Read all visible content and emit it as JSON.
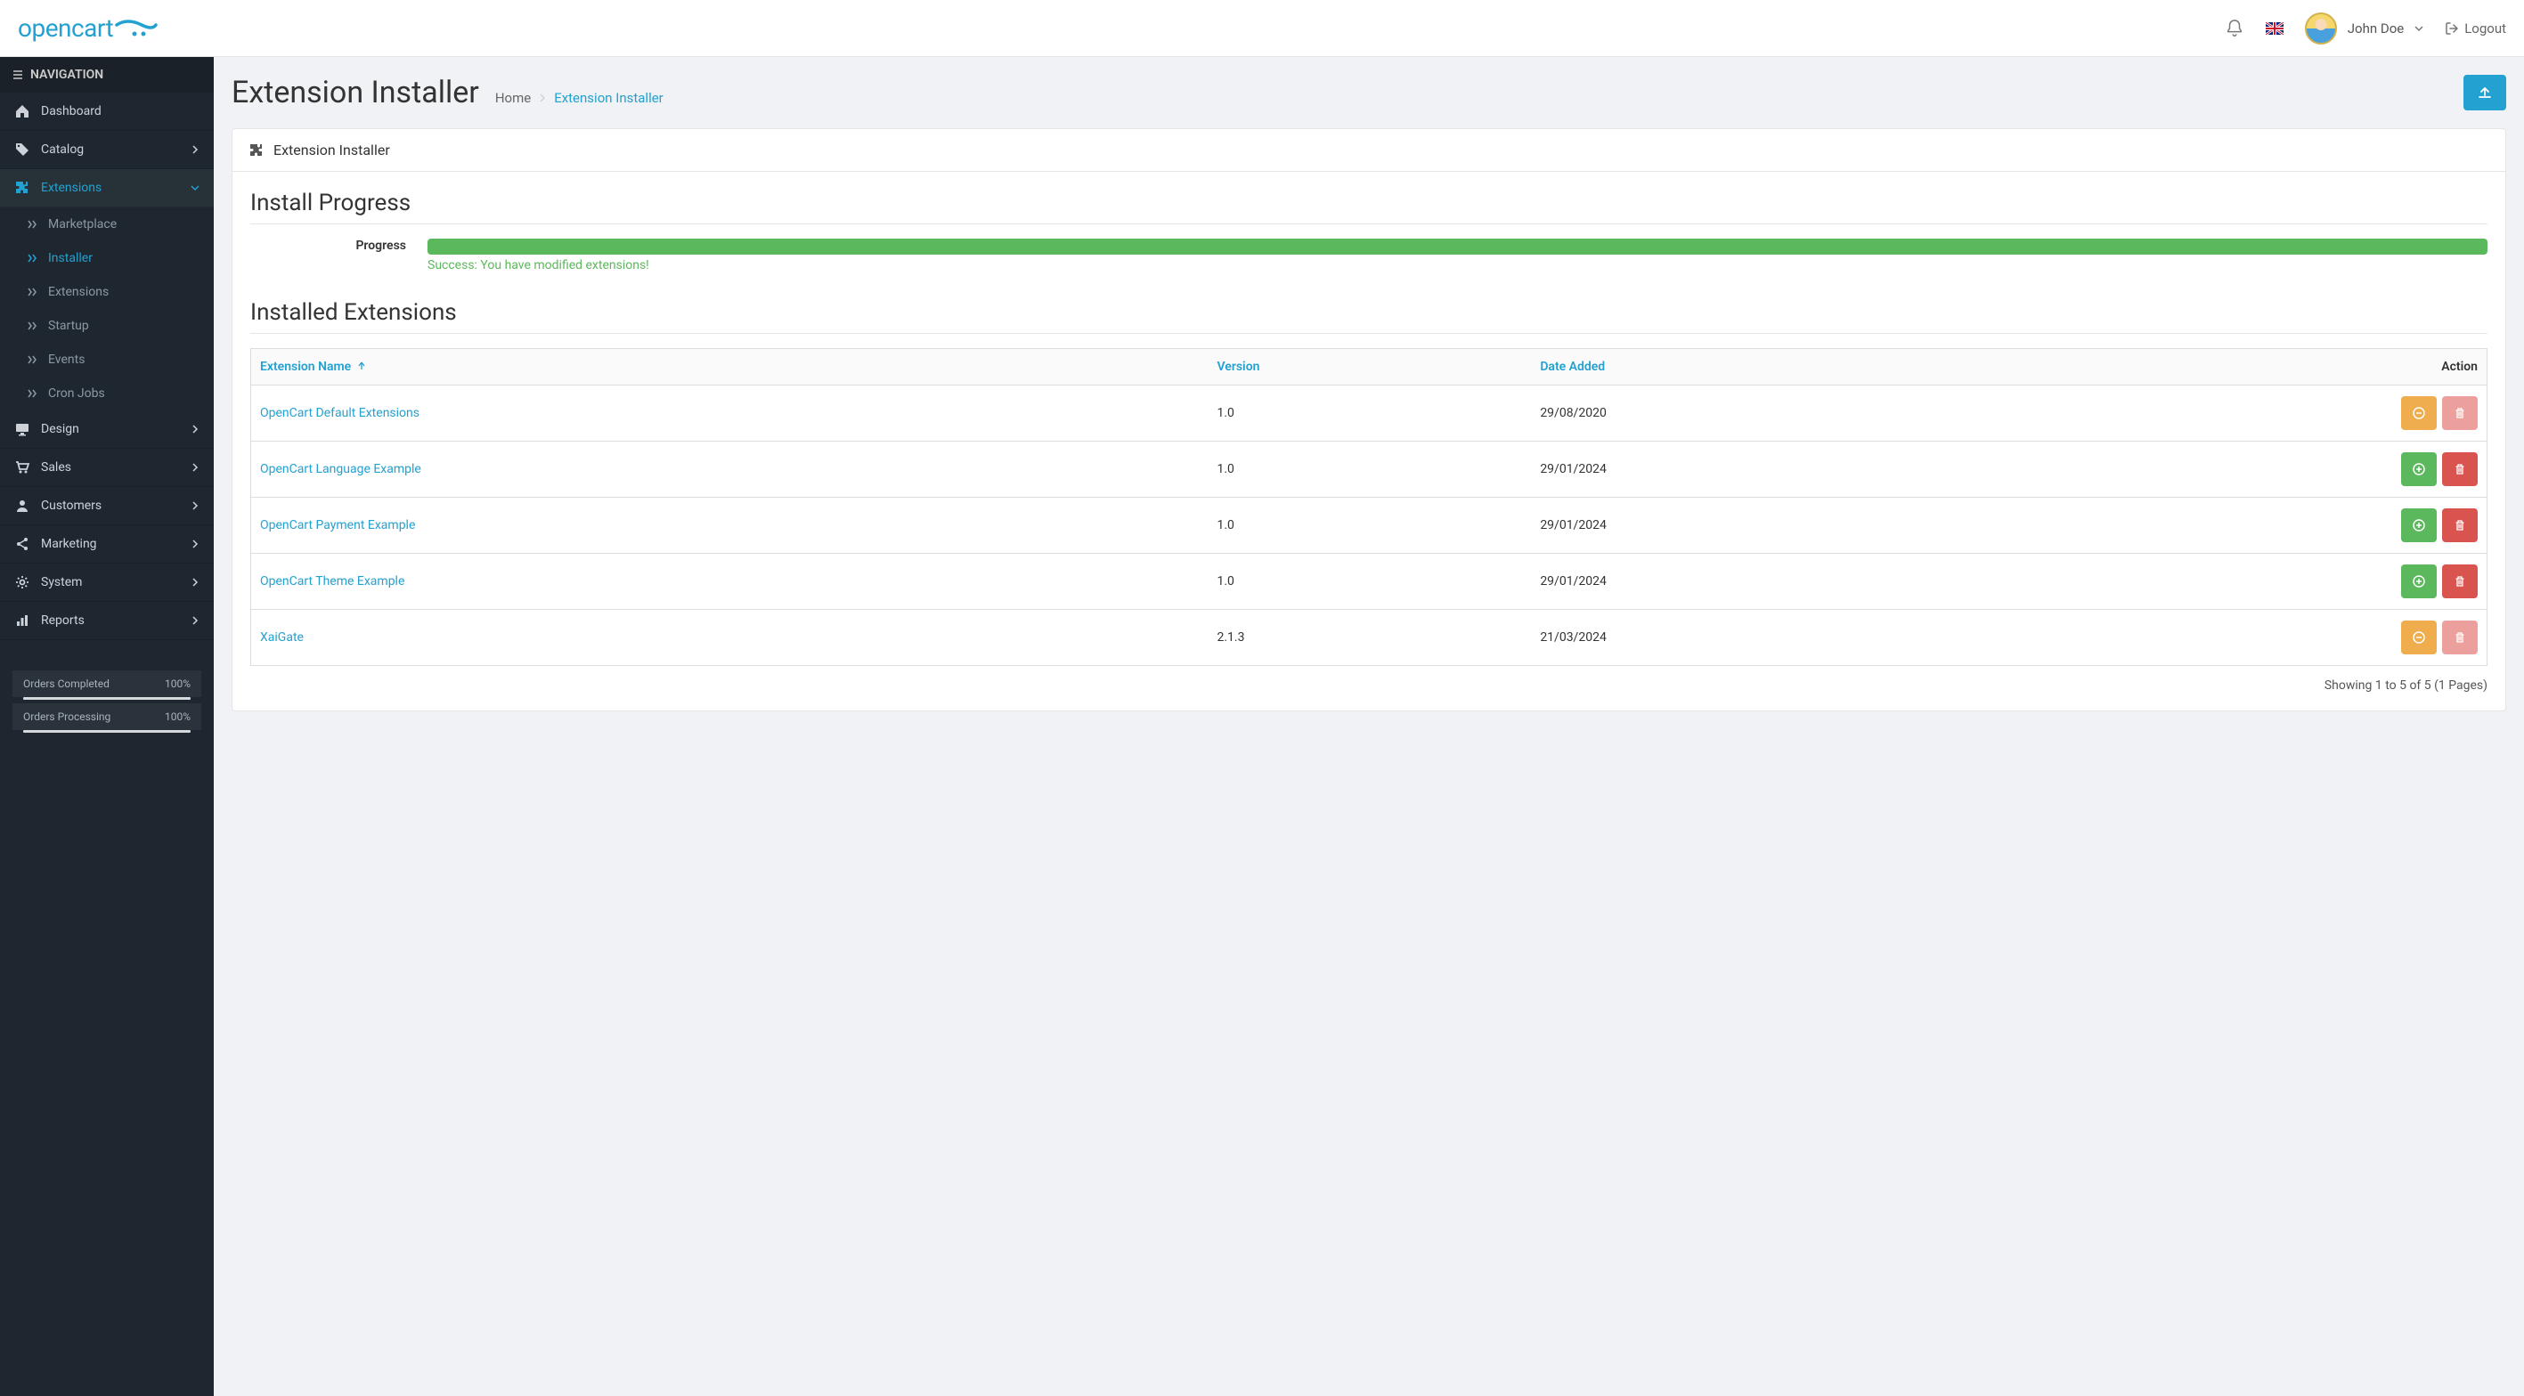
{
  "header": {
    "logo_text": "opencart",
    "user_name": "John Doe",
    "logout_label": "Logout"
  },
  "sidebar": {
    "nav_label": "NAVIGATION",
    "items": [
      {
        "icon": "home",
        "label": "Dashboard"
      },
      {
        "icon": "tag",
        "label": "Catalog",
        "expandable": true
      },
      {
        "icon": "puzzle",
        "label": "Extensions",
        "expandable": true,
        "active": true
      },
      {
        "icon": "monitor",
        "label": "Design",
        "expandable": true
      },
      {
        "icon": "cart",
        "label": "Sales",
        "expandable": true
      },
      {
        "icon": "user",
        "label": "Customers",
        "expandable": true
      },
      {
        "icon": "share",
        "label": "Marketing",
        "expandable": true
      },
      {
        "icon": "gear",
        "label": "System",
        "expandable": true
      },
      {
        "icon": "chart",
        "label": "Reports",
        "expandable": true
      }
    ],
    "sub_extensions": [
      {
        "label": "Marketplace"
      },
      {
        "label": "Installer",
        "active": true
      },
      {
        "label": "Extensions"
      },
      {
        "label": "Startup"
      },
      {
        "label": "Events"
      },
      {
        "label": "Cron Jobs"
      }
    ],
    "stats": [
      {
        "label": "Orders Completed",
        "value": "100%"
      },
      {
        "label": "Orders Processing",
        "value": "100%"
      }
    ]
  },
  "page": {
    "title": "Extension Installer",
    "breadcrumb_home": "Home",
    "breadcrumb_current": "Extension Installer",
    "panel_title": "Extension Installer",
    "progress_heading": "Install Progress",
    "progress_label": "Progress",
    "progress_message": "Success: You have modified extensions!",
    "installed_heading": "Installed Extensions",
    "columns": {
      "name": "Extension Name",
      "version": "Version",
      "date": "Date Added",
      "action": "Action"
    },
    "rows": [
      {
        "name": "OpenCart Default Extensions",
        "version": "1.0",
        "date": "29/08/2020",
        "install_state": "uninstall",
        "delete_disabled": true
      },
      {
        "name": "OpenCart Language Example",
        "version": "1.0",
        "date": "29/01/2024",
        "install_state": "install",
        "delete_disabled": false
      },
      {
        "name": "OpenCart Payment Example",
        "version": "1.0",
        "date": "29/01/2024",
        "install_state": "install",
        "delete_disabled": false
      },
      {
        "name": "OpenCart Theme Example",
        "version": "1.0",
        "date": "29/01/2024",
        "install_state": "install",
        "delete_disabled": false
      },
      {
        "name": "XaiGate",
        "version": "2.1.3",
        "date": "21/03/2024",
        "install_state": "uninstall",
        "delete_disabled": true
      }
    ],
    "pagination": "Showing 1 to 5 of 5 (1 Pages)"
  }
}
